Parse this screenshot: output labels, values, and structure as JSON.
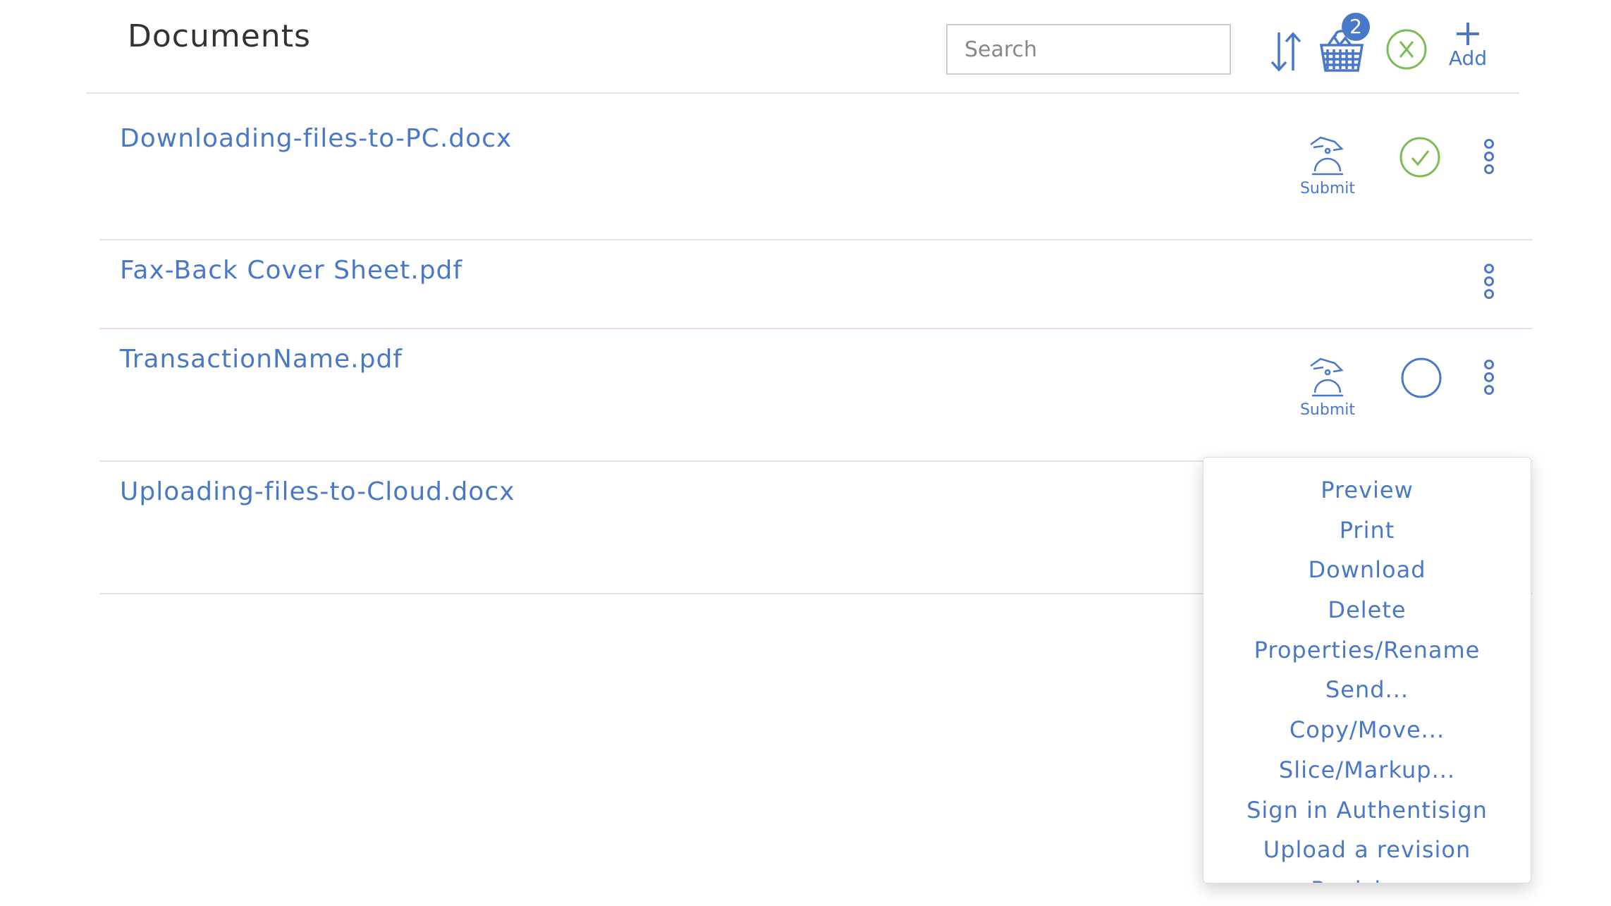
{
  "header": {
    "title": "Documents",
    "search_placeholder": "Search",
    "basket_count": "2",
    "add_label": "Add"
  },
  "colors": {
    "accent": "#4a78c8",
    "success": "#7dbb55"
  },
  "documents": [
    {
      "name": "Downloading-files-to-PC.docx",
      "submit_label": "Submit",
      "status": "checked"
    },
    {
      "name": "Fax-Back Cover Sheet.pdf"
    },
    {
      "name": "TransactionName.pdf",
      "submit_label": "Submit",
      "status": "unchecked"
    },
    {
      "name": "Uploading-files-to-Cloud.docx"
    }
  ],
  "context_menu": {
    "items": [
      "Preview",
      "Print",
      "Download",
      "Delete",
      "Properties/Rename",
      "Send...",
      "Copy/Move...",
      "Slice/Markup...",
      "Sign in Authentisign",
      "Upload a revision",
      "Revisions"
    ]
  }
}
